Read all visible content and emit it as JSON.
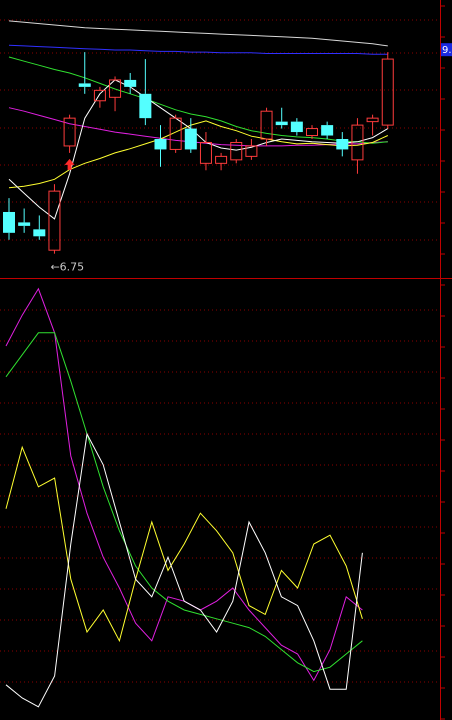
{
  "colors": {
    "background": "#000000",
    "frame": "#c00000",
    "grid": "#8b0000",
    "up_candle": "#ff3c3c",
    "down_candle": "#54ffff",
    "price_tag_bg": "#1a2ae0",
    "price_tag_text": "#ffffff",
    "signal_arrow": "#ff2a2a",
    "min_label": "#c8c8c8"
  },
  "price_tag_text": "9.",
  "chart_data": [
    {
      "type": "candlestick",
      "title": "",
      "ylim": [
        6.4,
        10.4
      ],
      "grid": true,
      "low_annotation": {
        "text": "←6.75",
        "value": 6.75,
        "index": 3
      },
      "buy_signal": {
        "index": 4,
        "icon": "up-arrow-icon"
      },
      "candles": [
        {
          "o": 7.35,
          "h": 7.55,
          "l": 6.95,
          "c": 7.05
        },
        {
          "o": 7.2,
          "h": 7.4,
          "l": 7.05,
          "c": 7.15
        },
        {
          "o": 7.1,
          "h": 7.3,
          "l": 6.95,
          "c": 7.0
        },
        {
          "o": 6.8,
          "h": 7.75,
          "l": 6.75,
          "c": 7.65
        },
        {
          "o": 8.3,
          "h": 8.75,
          "l": 8.2,
          "c": 8.7
        },
        {
          "o": 9.2,
          "h": 9.65,
          "l": 9.05,
          "c": 9.15
        },
        {
          "o": 8.95,
          "h": 9.15,
          "l": 8.85,
          "c": 9.1
        },
        {
          "o": 9.0,
          "h": 9.3,
          "l": 8.8,
          "c": 9.25
        },
        {
          "o": 9.25,
          "h": 9.35,
          "l": 9.05,
          "c": 9.15
        },
        {
          "o": 9.05,
          "h": 9.55,
          "l": 8.6,
          "c": 8.7
        },
        {
          "o": 8.4,
          "h": 8.6,
          "l": 8.0,
          "c": 8.25
        },
        {
          "o": 8.25,
          "h": 8.75,
          "l": 8.2,
          "c": 8.7
        },
        {
          "o": 8.55,
          "h": 8.7,
          "l": 8.2,
          "c": 8.25
        },
        {
          "o": 8.05,
          "h": 8.5,
          "l": 7.95,
          "c": 8.35
        },
        {
          "o": 8.05,
          "h": 8.2,
          "l": 7.95,
          "c": 8.15
        },
        {
          "o": 8.1,
          "h": 8.4,
          "l": 8.05,
          "c": 8.35
        },
        {
          "o": 8.15,
          "h": 8.4,
          "l": 8.1,
          "c": 8.3
        },
        {
          "o": 8.4,
          "h": 8.85,
          "l": 8.3,
          "c": 8.8
        },
        {
          "o": 8.65,
          "h": 8.85,
          "l": 8.55,
          "c": 8.6
        },
        {
          "o": 8.65,
          "h": 8.7,
          "l": 8.45,
          "c": 8.5
        },
        {
          "o": 8.45,
          "h": 8.6,
          "l": 8.4,
          "c": 8.55
        },
        {
          "o": 8.6,
          "h": 8.65,
          "l": 8.4,
          "c": 8.45
        },
        {
          "o": 8.4,
          "h": 8.5,
          "l": 8.15,
          "c": 8.25
        },
        {
          "o": 8.1,
          "h": 8.7,
          "l": 7.9,
          "c": 8.6
        },
        {
          "o": 8.65,
          "h": 8.75,
          "l": 8.45,
          "c": 8.7
        },
        {
          "o": 8.6,
          "h": 9.65,
          "l": 8.55,
          "c": 9.55
        }
      ],
      "series": [
        {
          "color": "#d8d8d8",
          "values": [
            10.1,
            10.08,
            10.06,
            10.04,
            10.02,
            10.0,
            9.99,
            9.98,
            9.97,
            9.96,
            9.95,
            9.94,
            9.93,
            9.92,
            9.91,
            9.9,
            9.89,
            9.88,
            9.87,
            9.86,
            9.85,
            9.83,
            9.81,
            9.79,
            9.77,
            9.74
          ]
        },
        {
          "color": "#3030ff",
          "values": [
            9.75,
            9.74,
            9.73,
            9.72,
            9.71,
            9.7,
            9.69,
            9.68,
            9.68,
            9.67,
            9.66,
            9.66,
            9.65,
            9.65,
            9.64,
            9.64,
            9.64,
            9.63,
            9.63,
            9.63,
            9.63,
            9.63,
            9.63,
            9.63,
            9.62,
            9.62
          ]
        },
        {
          "color": "#e020e0",
          "values": [
            8.85,
            8.8,
            8.74,
            8.68,
            8.62,
            8.58,
            8.54,
            8.5,
            8.47,
            8.44,
            8.41,
            8.38,
            8.36,
            8.34,
            8.32,
            8.31,
            8.3,
            8.3,
            8.3,
            8.31,
            8.31,
            8.32,
            8.33,
            8.33,
            8.35,
            8.36
          ]
        },
        {
          "color": "#30e030",
          "values": [
            9.58,
            9.52,
            9.46,
            9.4,
            9.35,
            9.28,
            9.2,
            9.12,
            9.05,
            8.98,
            8.9,
            8.82,
            8.76,
            8.72,
            8.66,
            8.58,
            8.52,
            8.48,
            8.45,
            8.43,
            8.42,
            8.4,
            8.37,
            8.36,
            8.34,
            8.36
          ]
        },
        {
          "color": "#ffff30",
          "values": [
            7.7,
            7.72,
            7.76,
            7.82,
            7.96,
            8.05,
            8.12,
            8.2,
            8.26,
            8.33,
            8.4,
            8.5,
            8.6,
            8.66,
            8.58,
            8.52,
            8.44,
            8.4,
            8.36,
            8.33,
            8.34,
            8.32,
            8.3,
            8.31,
            8.35,
            8.45
          ]
        },
        {
          "color": "#ffffff",
          "values": [
            7.82,
            7.62,
            7.42,
            7.25,
            7.9,
            8.7,
            9.05,
            9.25,
            9.15,
            9.0,
            8.85,
            8.7,
            8.55,
            8.35,
            8.27,
            8.24,
            8.28,
            8.35,
            8.4,
            8.38,
            8.36,
            8.35,
            8.34,
            8.36,
            8.42,
            8.55
          ]
        }
      ]
    },
    {
      "type": "line",
      "title": "",
      "ylim": [
        0,
        100
      ],
      "grid": true,
      "series": [
        {
          "color": "#e020e0",
          "values": [
            85,
            92,
            98,
            88,
            60,
            47,
            37,
            30,
            22,
            18,
            28,
            27,
            25,
            27,
            30,
            25,
            21,
            17,
            15,
            9,
            16,
            28,
            25
          ]
        },
        {
          "color": "#30e030",
          "values": [
            78,
            83,
            88,
            88,
            77,
            65,
            53,
            43,
            35,
            30,
            27,
            25,
            24,
            23,
            22,
            21,
            19,
            16,
            13,
            11,
            12,
            15,
            18
          ]
        },
        {
          "color": "#ffff30",
          "values": [
            48,
            62,
            53,
            55,
            32,
            20,
            25,
            18,
            32,
            45,
            34,
            40,
            47,
            43,
            38,
            26,
            24,
            34,
            30,
            40,
            42,
            35,
            23
          ]
        },
        {
          "color": "#ffffff",
          "values": [
            8,
            5,
            3,
            10,
            40,
            65,
            58,
            45,
            32,
            28,
            37,
            27,
            25,
            20,
            27,
            45,
            38,
            28,
            26,
            18,
            7,
            7,
            38
          ]
        }
      ]
    }
  ]
}
